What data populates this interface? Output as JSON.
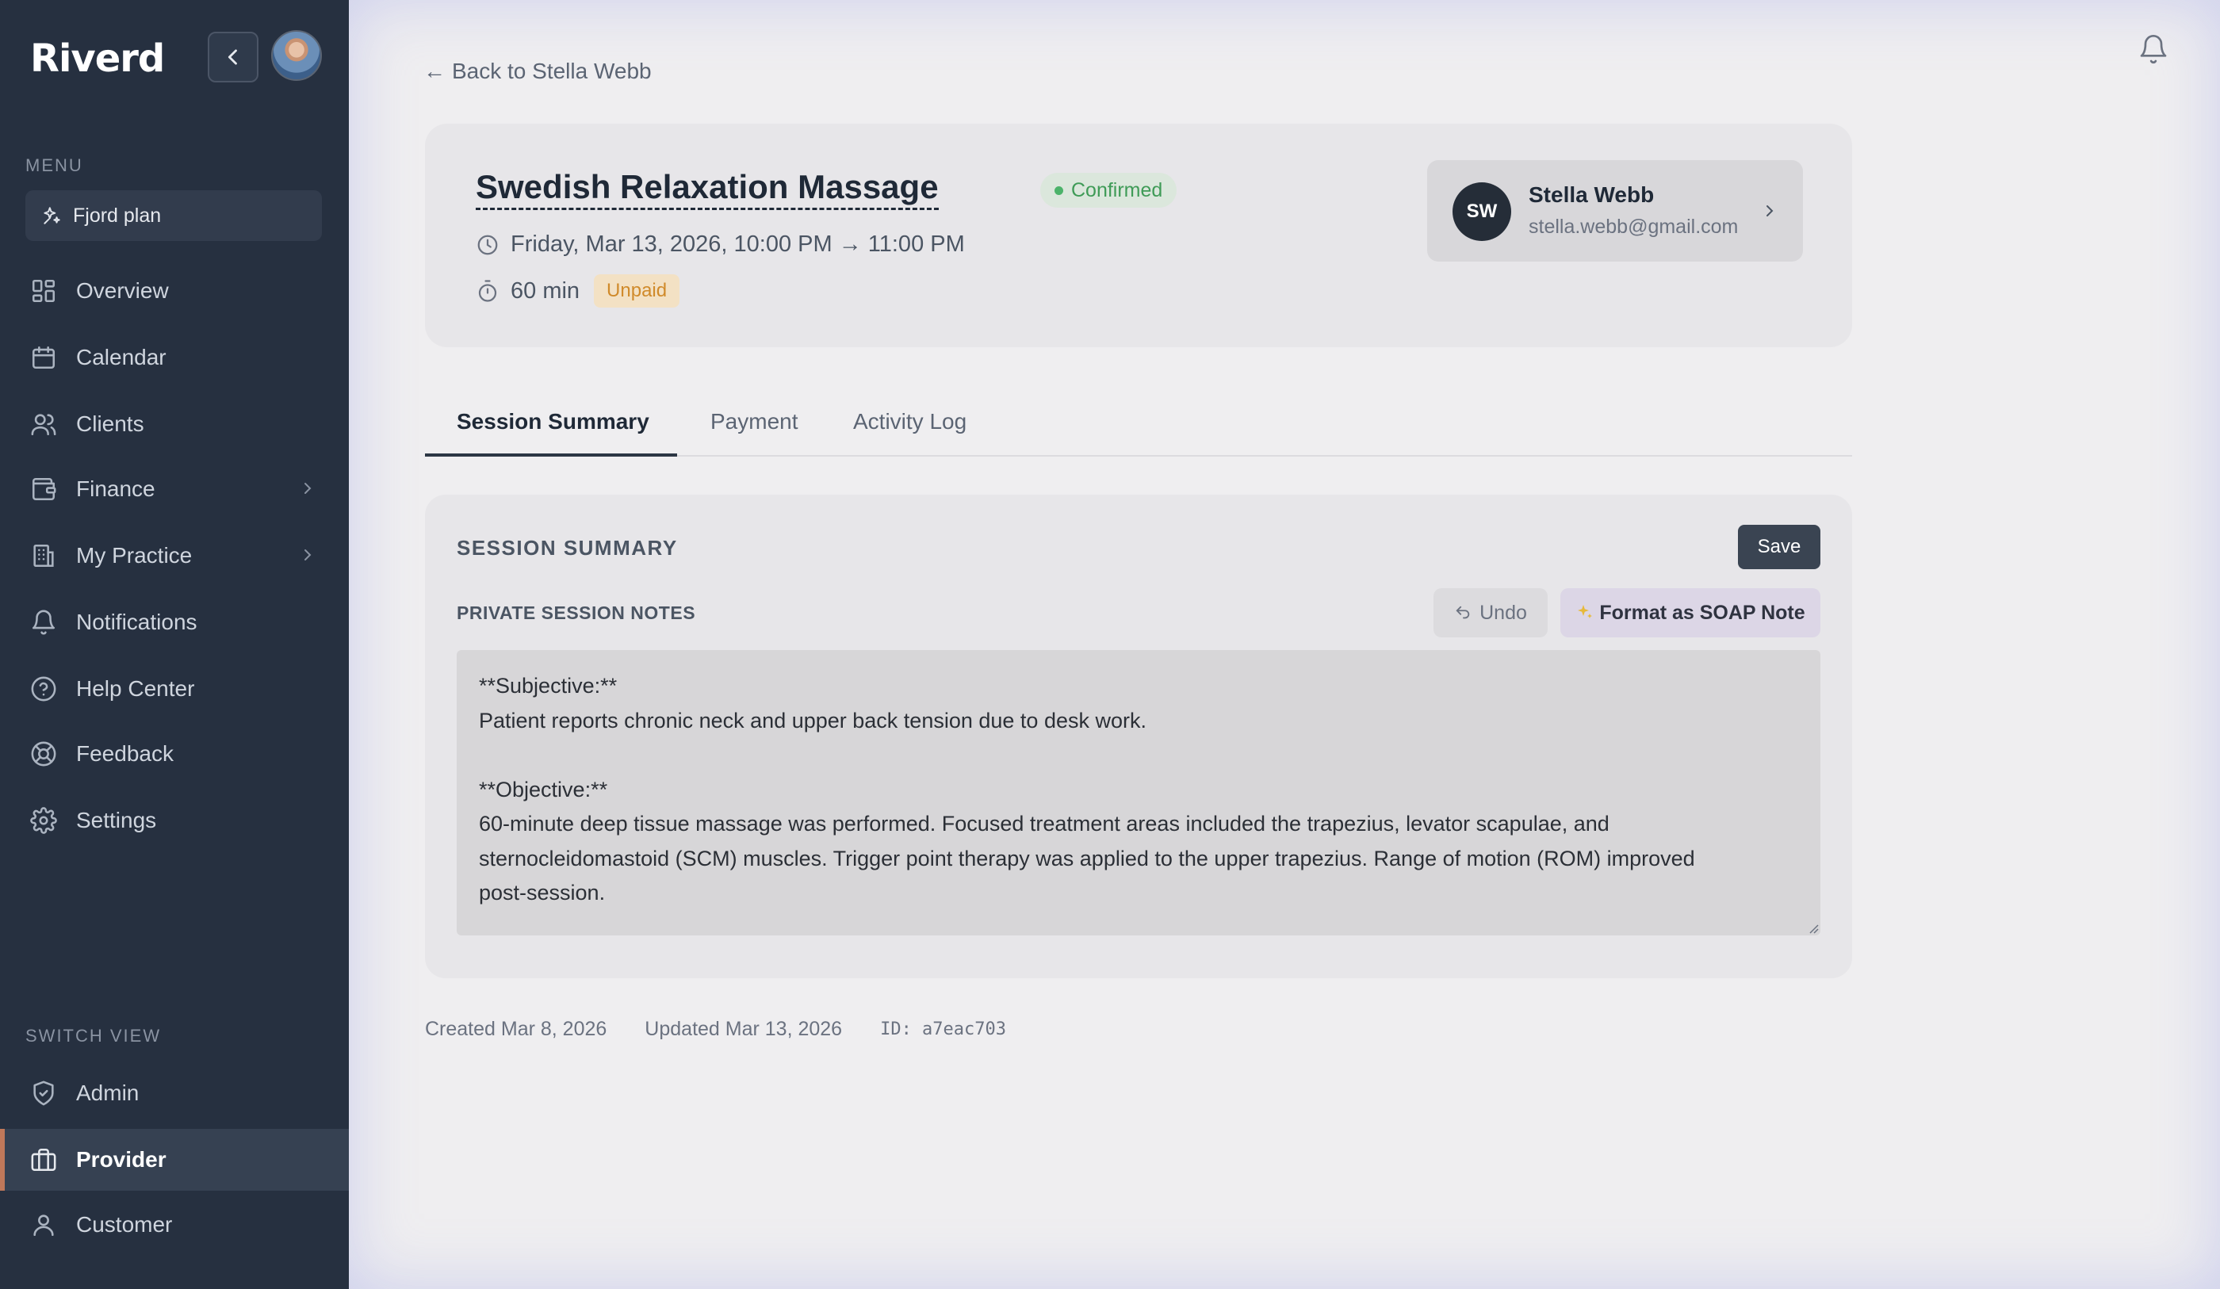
{
  "app": {
    "logo": "Riverd"
  },
  "sidebar": {
    "menu_label": "MENU",
    "plan_label": "Fjord plan",
    "items": [
      {
        "label": "Overview",
        "icon": "grid-icon"
      },
      {
        "label": "Calendar",
        "icon": "calendar-icon"
      },
      {
        "label": "Clients",
        "icon": "users-icon"
      },
      {
        "label": "Finance",
        "icon": "wallet-icon",
        "has_submenu": true
      },
      {
        "label": "My Practice",
        "icon": "building-icon",
        "has_submenu": true
      },
      {
        "label": "Notifications",
        "icon": "bell-icon"
      },
      {
        "label": "Help Center",
        "icon": "help-circle-icon"
      },
      {
        "label": "Feedback",
        "icon": "life-buoy-icon"
      },
      {
        "label": "Settings",
        "icon": "gear-icon"
      }
    ],
    "switch_view_label": "SWITCH VIEW",
    "views": [
      {
        "label": "Admin",
        "icon": "shield-icon"
      },
      {
        "label": "Provider",
        "icon": "briefcase-icon",
        "active": true
      },
      {
        "label": "Customer",
        "icon": "user-icon"
      }
    ]
  },
  "header": {
    "back_label": "Back to Stella Webb",
    "back_arrow": "←"
  },
  "appointment": {
    "title": "Swedish Relaxation Massage",
    "status": "Confirmed",
    "datetime": "Friday, Mar 13, 2026, 10:00 PM → 11:00 PM",
    "duration": "60 min",
    "payment_status": "Unpaid",
    "status_colors": {
      "confirmed": "#4cb36a",
      "unpaid": "#d08a2a"
    }
  },
  "client": {
    "initials": "SW",
    "name": "Stella Webb",
    "email": "stella.webb@gmail.com"
  },
  "tabs": [
    {
      "label": "Session Summary",
      "active": true
    },
    {
      "label": "Payment"
    },
    {
      "label": "Activity Log"
    }
  ],
  "session": {
    "panel_title": "SESSION SUMMARY",
    "save_label": "Save",
    "notes_label": "PRIVATE SESSION NOTES",
    "undo_label": "Undo",
    "soap_label": "Format as SOAP Note",
    "notes_text": "**Subjective:**\nPatient reports chronic neck and upper back tension due to desk work.\n\n**Objective:**\n60-minute deep tissue massage was performed. Focused treatment areas included the trapezius, levator scapulae, and\nsternocleidomastoid (SCM) muscles. Trigger point therapy was applied to the upper trapezius. Range of motion (ROM) improved\npost-session."
  },
  "footer": {
    "created": "Created Mar 8, 2026",
    "updated": "Updated Mar 13, 2026",
    "id": "ID: a7eac703"
  },
  "colors": {
    "sidebar_bg": "#263040",
    "accent": "#c0785a",
    "primary_button": "#3a4452"
  }
}
